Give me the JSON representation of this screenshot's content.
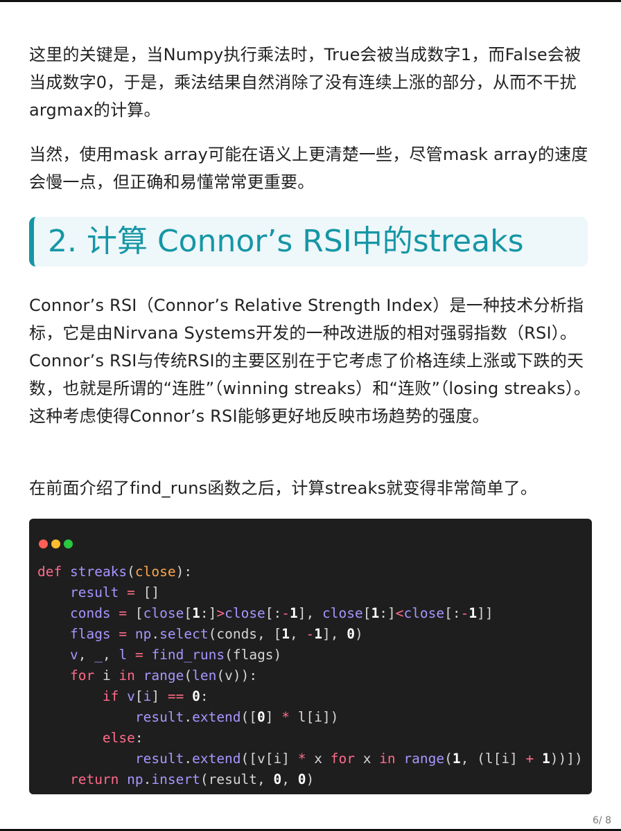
{
  "paragraphs": {
    "p1": "这里的关键是，当Numpy执行乘法时，True会被当成数字1，而False会被当成数字0，于是，乘法结果自然消除了没有连续上涨的部分，从而不干扰argmax的计算。",
    "p2": "当然，使用mask array可能在语义上更清楚一些，尽管mask array的速度会慢一点，但正确和易懂常常更重要。",
    "p3": "Connor’s RSI（Connor’s Relative Strength Index）是一种技术分析指标，它是由Nirvana Systems开发的一种改进版的相对强弱指数（RSI）。Connor’s RSI与传统RSI的主要区别在于它考虑了价格连续上涨或下跌的天数，也就是所谓的“连胜”（winning streaks）和“连败”（losing streaks）。这种考虑使得Connor’s RSI能够更好地反映市场趋势的强度。",
    "p4": "在前面介绍了find_runs函数之后，计算streaks就变得非常简单了。"
  },
  "heading": "2. 计算 Connor’s RSI中的streaks",
  "code": {
    "kw_def": "def",
    "fn_name": "streaks",
    "param": "close",
    "kw_for": "for",
    "kw_in": "in",
    "kw_if": "if",
    "kw_else": "else",
    "kw_return": "return"
  },
  "page_number": "6/ 8"
}
